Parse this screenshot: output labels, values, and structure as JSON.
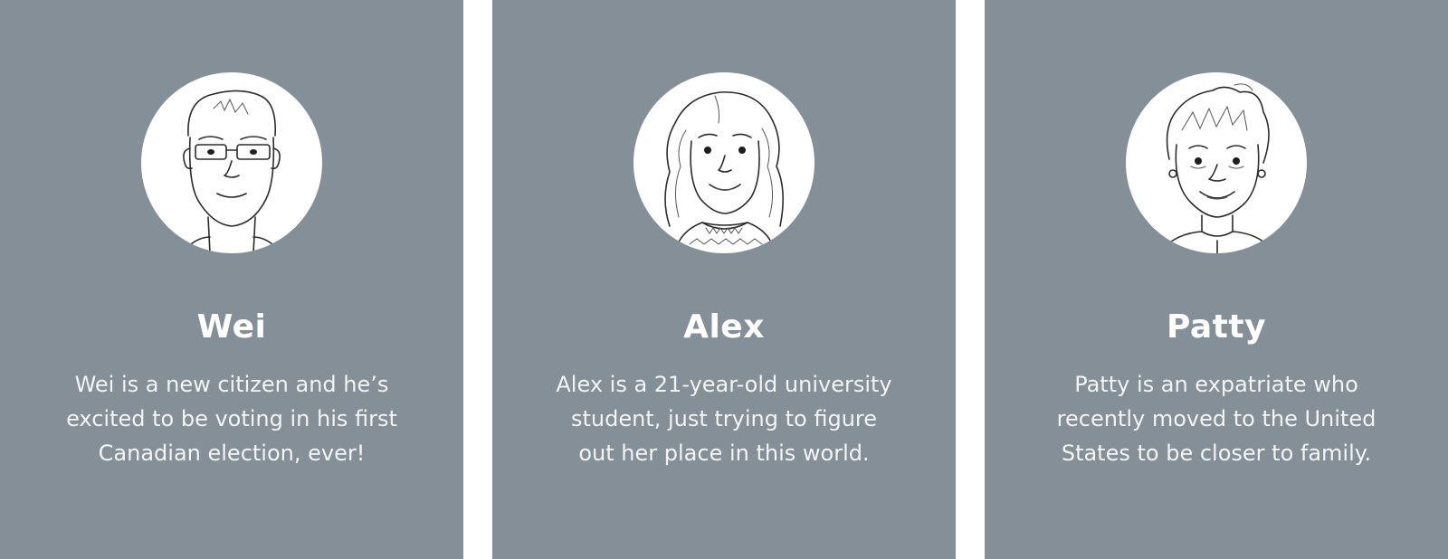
{
  "personas": [
    {
      "name": "Wei",
      "bio_lines": [
        "Wei is a new citizen and he’s",
        "excited to be voting in his first",
        "Canadian election, ever!"
      ]
    },
    {
      "name": "Alex",
      "bio_lines": [
        "Alex is a 21-year-old university",
        "student, just trying to figure",
        "out her place in this world."
      ]
    },
    {
      "name": "Patty",
      "bio_lines": [
        "Patty is an expatriate who",
        "recently moved to the United",
        "States to be closer to family."
      ]
    }
  ],
  "colors": {
    "card_background": "#858f98",
    "text": "#ffffff",
    "avatar_background": "#ffffff",
    "page_background": "#ffffff"
  }
}
